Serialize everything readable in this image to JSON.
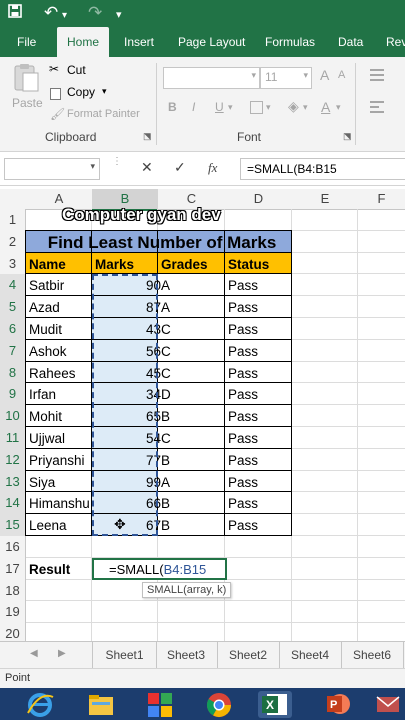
{
  "qat": {
    "undo_arrow": "↶",
    "redo_arrow": "↷",
    "more": "▾"
  },
  "ribbon_tabs": [
    "File",
    "Home",
    "Insert",
    "Page Layout",
    "Formulas",
    "Data",
    "Rev"
  ],
  "clipboard": {
    "paste": "Paste",
    "cut": "Cut",
    "copy": "Copy",
    "format_painter": "Format Painter",
    "group": "Clipboard"
  },
  "font": {
    "size": "11",
    "bold": "B",
    "italic": "I",
    "underline": "U",
    "group": "Font"
  },
  "formula_bar": {
    "cancel": "✕",
    "enter": "✓",
    "fx": "fx",
    "formula": "=SMALL(B4:B15"
  },
  "columns": [
    "A",
    "B",
    "C",
    "D",
    "E",
    "F"
  ],
  "rows": [
    "1",
    "2",
    "3",
    "4",
    "5",
    "6",
    "7",
    "8",
    "9",
    "10",
    "11",
    "12",
    "13",
    "14",
    "15",
    "16",
    "17",
    "18",
    "19",
    "20"
  ],
  "overlay_text": "Computer gyan dev",
  "table": {
    "title": "Find Least Number of Marks",
    "headers": [
      "Name",
      "Marks",
      "Grades",
      "Status"
    ],
    "records": [
      [
        "Satbir",
        "90",
        "A",
        "Pass"
      ],
      [
        "Azad",
        "87",
        "A",
        "Pass"
      ],
      [
        "Mudit",
        "43",
        "C",
        "Pass"
      ],
      [
        "Ashok",
        "56",
        "C",
        "Pass"
      ],
      [
        "Rahees",
        "45",
        "C",
        "Pass"
      ],
      [
        "Irfan",
        "34",
        "D",
        "Pass"
      ],
      [
        "Mohit",
        "65",
        "B",
        "Pass"
      ],
      [
        "Ujjwal",
        "54",
        "C",
        "Pass"
      ],
      [
        "Priyanshi",
        "77",
        "B",
        "Pass"
      ],
      [
        "Siya",
        "99",
        "A",
        "Pass"
      ],
      [
        "Himanshu",
        "66",
        "B",
        "Pass"
      ],
      [
        "Leena",
        "67",
        "B",
        "Pass"
      ]
    ]
  },
  "result": {
    "label": "Result",
    "formula_prefix": "=SMALL(",
    "formula_range": "B4:B15",
    "tooltip": "SMALL(array, k)"
  },
  "sheet_tabs": [
    "Sheet1",
    "Sheet3",
    "Sheet2",
    "Sheet4",
    "Sheet6"
  ],
  "status": "Point",
  "colors": {
    "excel_green": "#217346",
    "title_fill": "#8ea9db",
    "header_fill": "#ffc000",
    "range_blue": "#2f5597"
  }
}
